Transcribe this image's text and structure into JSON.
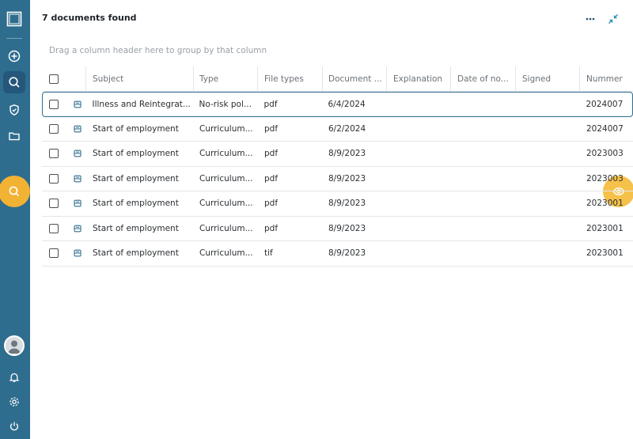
{
  "header": {
    "title": "7 documents found",
    "more_icon": "more-horizontal-icon",
    "collapse_icon": "collapse-icon"
  },
  "group_hint": "Drag a column header here to group by that column",
  "sidebar": {
    "items": [
      {
        "name": "app-logo-icon"
      },
      {
        "name": "add-icon"
      },
      {
        "name": "search-icon",
        "active": true
      },
      {
        "name": "shield-icon"
      },
      {
        "name": "folder-icon"
      }
    ],
    "bottom": [
      {
        "name": "avatar"
      },
      {
        "name": "bell-icon"
      },
      {
        "name": "gear-icon"
      },
      {
        "name": "power-icon"
      }
    ]
  },
  "columns": [
    "Subject",
    "Type",
    "File types",
    "Document ...",
    "Explanation",
    "Date of no...",
    "Signed",
    "Nummer"
  ],
  "rows": [
    {
      "subject": "Illness and Reintegrat...",
      "type": "No-risk pol...",
      "file_type": "pdf",
      "date": "6/4/2024",
      "number": "2024007"
    },
    {
      "subject": "Start of employment",
      "type": "Curriculum...",
      "file_type": "pdf",
      "date": "6/2/2024",
      "number": "2024007"
    },
    {
      "subject": "Start of employment",
      "type": "Curriculum...",
      "file_type": "pdf",
      "date": "8/9/2023",
      "number": "2023003"
    },
    {
      "subject": "Start of employment",
      "type": "Curriculum...",
      "file_type": "pdf",
      "date": "8/9/2023",
      "number": "2023003"
    },
    {
      "subject": "Start of employment",
      "type": "Curriculum...",
      "file_type": "pdf",
      "date": "8/9/2023",
      "number": "2023001"
    },
    {
      "subject": "Start of employment",
      "type": "Curriculum...",
      "file_type": "pdf",
      "date": "8/9/2023",
      "number": "2023001"
    },
    {
      "subject": "Start of employment",
      "type": "Curriculum...",
      "file_type": "tif",
      "date": "8/9/2023",
      "number": "2023001"
    }
  ],
  "colors": {
    "sidebar": "#2f6d8e",
    "accent": "#f2b233",
    "selected_border": "#2f6d8e"
  }
}
